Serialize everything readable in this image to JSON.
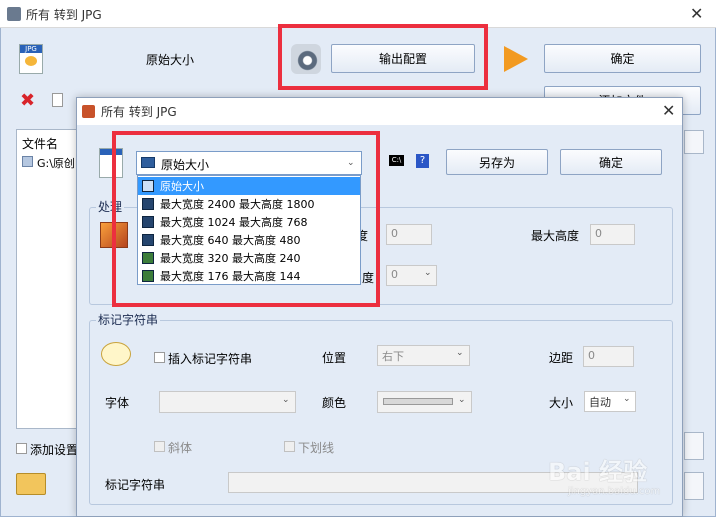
{
  "back_window": {
    "title": "所有 转到 JPG",
    "size_label": "原始大小",
    "output_config_button": "输出配置",
    "ok_button": "确定",
    "add_file_button": "添加文件",
    "file_list_header": "文件名",
    "file_row": "G:\\原创",
    "add_settings_checkbox": "添加设置"
  },
  "dialog": {
    "title": "所有 转到 JPG",
    "size_select": "原始大小",
    "save_as_button": "另存为",
    "ok_button": "确定",
    "help_label": "?",
    "process_group_label": "处理",
    "max_height_label": "最大高度",
    "max_width_value": "0",
    "max_height_value": "0",
    "angle_value": "0",
    "dropdown_options": [
      "原始大小",
      "最大宽度 2400 最大高度 1800",
      "最大宽度 1024 最大高度 768",
      "最大宽度 640 最大高度 480",
      "最大宽度 320 最大高度 240",
      "最大宽度 176 最大高度 144"
    ],
    "watermark_group": {
      "title": "标记字符串",
      "insert_checkbox": "插入标记字符串",
      "position_label": "位置",
      "position_value": "右下",
      "margin_label": "边距",
      "margin_value": "0",
      "font_label": "字体",
      "color_label": "颜色",
      "size_label": "大小",
      "size_value": "自动",
      "italic_label": "斜体",
      "underline_label": "下划线",
      "string_label": "标记字符串"
    }
  },
  "watermark": {
    "brand": "Bai 经验",
    "url": "jingyan.baidu.com"
  },
  "colors": {
    "highlight_box": "#ec2f3f",
    "selection": "#3399ff"
  }
}
